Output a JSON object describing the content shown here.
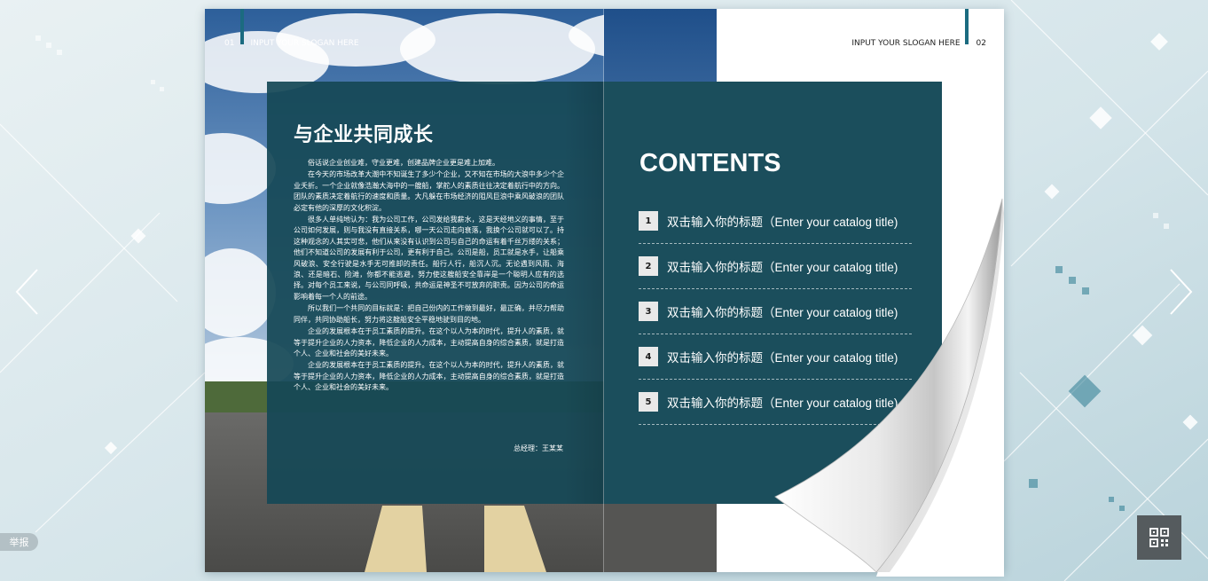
{
  "book": {
    "left_page": {
      "page_number": "01",
      "slogan": "INPUT YOUR SLOGAN HERE",
      "title": "与企业共同成长",
      "paragraphs": [
        "俗话说企业创业难，守业更难，创建品牌企业更是难上加难。",
        "在今天的市场改革大潮中不知诞生了多少个企业，又不知在市场的大浪中多少个企业夭折。一个企业就像浩瀚大海中的一艘船，掌舵人的素质往往决定着航行中的方向。团队的素质决定着航行的速度和质量。大凡躲在市场经济的阻风巨浪中乘风破浪的团队必定有他的深厚的文化积淀。",
        "很多人单纯地认为：我为公司工作，公司发给我薪水，这是天经地义的事情，至于公司如何发展，则与我没有直接关系，哪一天公司走向衰落，我换个公司就可以了。持这种观念的人其实可悲，他们从来没有认识到公司与自己的命运有着千丝万缕的关系；他们不知道公司的发展有利于公司，更有利于自己。公司是船，员工就是水手，让船乘风破浪、安全行驶是水手无可推卸的责任。船行人行，船沉人沉。无论遇到风雨、海浪、还是暗石、险滩，你都不能逃避，努力使这艘船安全靠岸是一个聪明人应有的选择。对每个员工来说，与公司同呼吸，共命运是神圣不可放弃的职责。因为公司的命运影响着每一个人的前途。",
        "所以我们一个共同的目标就是：把自己份内的工作做到最好，最正确，并尽力帮助同伴，共同协助船长，努力将这艘船安全平稳地驶到目的地。",
        "企业的发展根本在于员工素质的提升。在这个以人为本的时代，提升人的素质，就等于提升企业的人力资本，降低企业的人力成本，主动提高自身的综合素质，就是打造个人、企业和社会的美好未来。",
        "企业的发展根本在于员工素质的提升。在这个以人为本的时代，提升人的素质，就等于提升企业的人力资本，降低企业的人力成本，主动提高自身的综合素质，就是打造个人、企业和社会的美好未来。"
      ],
      "signature": "总经理：王某某"
    },
    "right_page": {
      "page_number": "02",
      "slogan": "INPUT YOUR SLOGAN HERE",
      "contents_title": "CONTENTS",
      "toc": [
        {
          "num": "1",
          "label": "双击输入你的标题（Enter your catalog title)"
        },
        {
          "num": "2",
          "label": "双击输入你的标题（Enter your catalog title)"
        },
        {
          "num": "3",
          "label": "双击输入你的标题（Enter your catalog title)"
        },
        {
          "num": "4",
          "label": "双击输入你的标题（Enter your catalog title)"
        },
        {
          "num": "5",
          "label": "双击输入你的标题（Enter your catalog title)"
        }
      ]
    }
  },
  "report_label": "举报",
  "icons": {
    "prev": "chevron-left-icon",
    "next": "chevron-right-icon",
    "qr": "qr-code-icon"
  },
  "colors": {
    "panel": "#1b4e5c",
    "accent_bar": "#1b6b80"
  }
}
